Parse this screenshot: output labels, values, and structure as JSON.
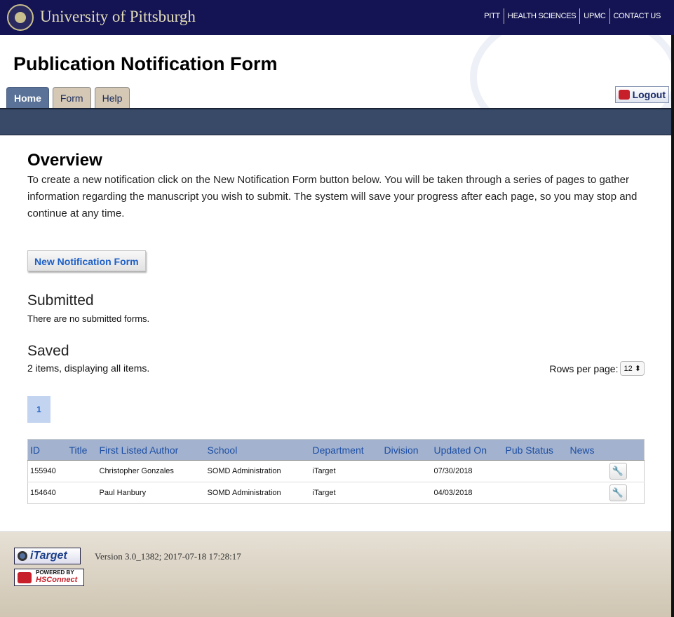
{
  "topbar": {
    "university": "University of Pittsburgh",
    "links": [
      "PITT",
      "HEALTH SCIENCES",
      "UPMC",
      "CONTACT US"
    ]
  },
  "header": {
    "title": "Publication Notification Form",
    "tabs": [
      "Home",
      "Form",
      "Help"
    ],
    "logout": "Logout"
  },
  "main": {
    "heading": "Overview",
    "intro": "To create a new notification click on the New Notification Form button below. You will be taken through a series of pages to gather information regarding the manuscript you wish to submit. The system will save your progress after each page, so you may stop and continue at any time.",
    "new_button": "New Notification Form",
    "submitted_heading": "Submitted",
    "submitted_text": "There are no submitted forms.",
    "saved_heading": "Saved",
    "saved_text": "2 items, displaying all items.",
    "rows_per_page_label": "Rows per page:",
    "rows_per_page_value": "12",
    "page": "1"
  },
  "table": {
    "columns": [
      "ID",
      "Title",
      "First Listed Author",
      "School",
      "Department",
      "Division",
      "Updated On",
      "Pub Status",
      "News"
    ],
    "rows": [
      [
        "155940",
        "",
        "Christopher Gonzales",
        "SOMD Administration",
        "iTarget",
        "",
        "07/30/2018",
        "",
        ""
      ],
      [
        "154640",
        "",
        "Paul Hanbury",
        "SOMD Administration",
        "iTarget",
        "",
        "04/03/2018",
        "",
        ""
      ]
    ]
  },
  "footer": {
    "itarget_logo": "iTarget",
    "hsconnect_logo": "Powered by HSConnect",
    "version": "Version 3.0_1382; 2017-07-18 17:28:17"
  }
}
